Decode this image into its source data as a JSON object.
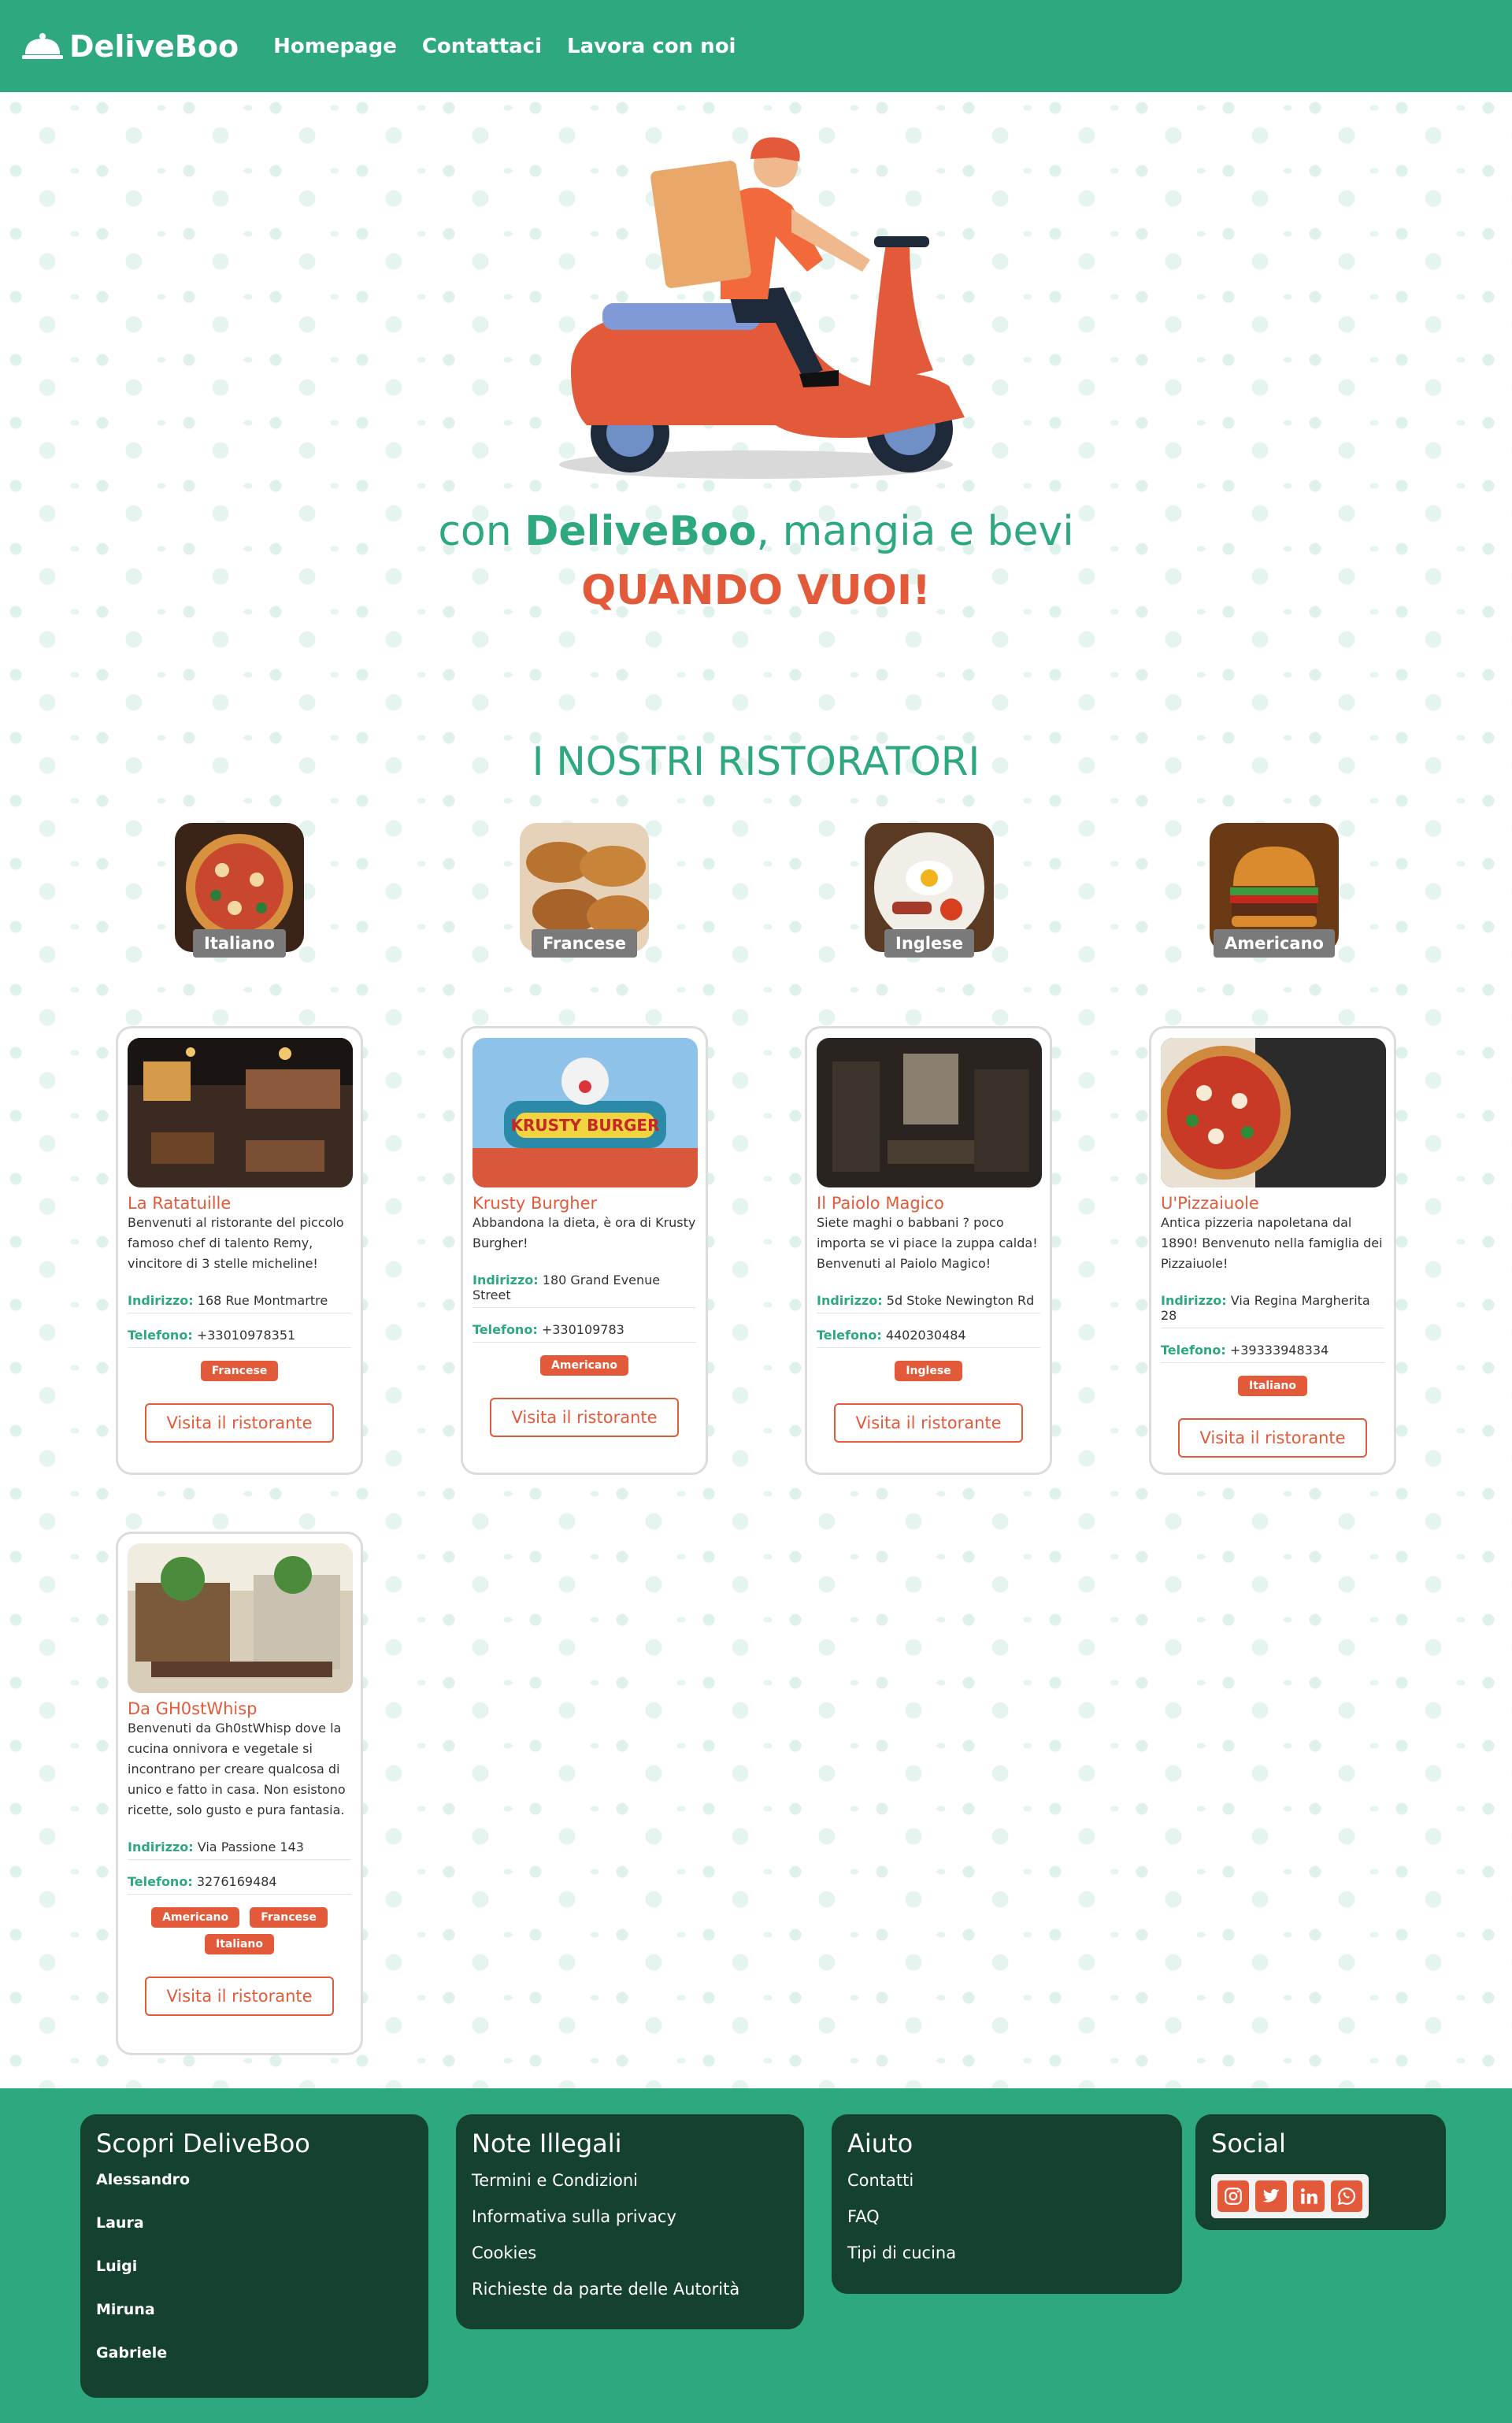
{
  "header": {
    "brand": "DeliveBoo",
    "nav": [
      {
        "label": "Homepage"
      },
      {
        "label": "Contattaci"
      },
      {
        "label": "Lavora con noi"
      }
    ]
  },
  "hero": {
    "line1_prefix": "con",
    "line1_brand": "DeliveBoo",
    "line1_suffix": ", mangia e bevi",
    "line2": "QUANDO VUOI!"
  },
  "section_title": "I NOSTRI RISTORATORI",
  "categories": [
    {
      "label": "Italiano",
      "icon": "pizza-image"
    },
    {
      "label": "Francese",
      "icon": "croissant-image"
    },
    {
      "label": "Inglese",
      "icon": "english-breakfast-image"
    },
    {
      "label": "Americano",
      "icon": "burger-image"
    }
  ],
  "restaurants": [
    {
      "name": "La Ratatuille",
      "description": "Benvenuti al ristorante del piccolo famoso chef di talento Remy, vincitore di 3 stelle micheline!",
      "address_label": "Indirizzo:",
      "address": "168 Rue Montmartre",
      "phone_label": "Telefono:",
      "phone": "+33010978351",
      "badges": [
        "Francese"
      ],
      "button": "Visita il ristorante"
    },
    {
      "name": "Krusty Burgher",
      "description": "Abbandona la dieta, è ora di Krusty Burgher!",
      "address_label": "Indirizzo:",
      "address": "180 Grand Evenue Street",
      "phone_label": "Telefono:",
      "phone": "+330109783",
      "badges": [
        "Americano"
      ],
      "button": "Visita il ristorante",
      "image_text": "KRUSTY BURGER"
    },
    {
      "name": "Il Paiolo Magico",
      "description": "Siete maghi o babbani ? poco importa se vi piace la zuppa calda! Benvenuti al Paiolo Magico!",
      "address_label": "Indirizzo:",
      "address": "5d Stoke Newington Rd",
      "phone_label": "Telefono:",
      "phone": "4402030484",
      "badges": [
        "Inglese"
      ],
      "button": "Visita il ristorante"
    },
    {
      "name": "U'Pizzaiuole",
      "description": "Antica pizzeria napoletana dal 1890! Benvenuto nella famiglia dei Pizzaiuole!",
      "address_label": "Indirizzo:",
      "address": "Via Regina Margherita 28",
      "phone_label": "Telefono:",
      "phone": "+39333948334",
      "badges": [
        "Italiano"
      ],
      "button": "Visita il ristorante"
    },
    {
      "name": "Da GH0stWhisp",
      "description": "Benvenuti da Gh0stWhisp dove la cucina onnivora e vegetale si incontrano per creare qualcosa di unico e fatto in casa. Non esistono ricette, solo gusto e pura fantasia.",
      "address_label": "Indirizzo:",
      "address": "Via Passione 143",
      "phone_label": "Telefono:",
      "phone": "3276169484",
      "badges": [
        "Americano",
        "Francese",
        "Italiano"
      ],
      "button": "Visita il ristorante"
    }
  ],
  "footer": {
    "discover": {
      "title": "Scopri DeliveBoo",
      "items": [
        "Alessandro",
        "Laura",
        "Luigi",
        "Miruna",
        "Gabriele"
      ]
    },
    "legal": {
      "title": "Note Illegali",
      "items": [
        "Termini e Condizioni",
        "Informativa sulla privacy",
        "Cookies",
        "Richieste da parte delle Autorità"
      ]
    },
    "help": {
      "title": "Aiuto",
      "items": [
        "Contatti",
        "FAQ",
        "Tipi di cucina"
      ]
    },
    "social": {
      "title": "Social",
      "icons": [
        "instagram-icon",
        "twitter-icon",
        "linkedin-icon",
        "whatsapp-icon"
      ]
    }
  },
  "colors": {
    "brand_green": "#2ea87e",
    "accent_orange": "#e35a3a",
    "footer_box": "#15412f"
  }
}
